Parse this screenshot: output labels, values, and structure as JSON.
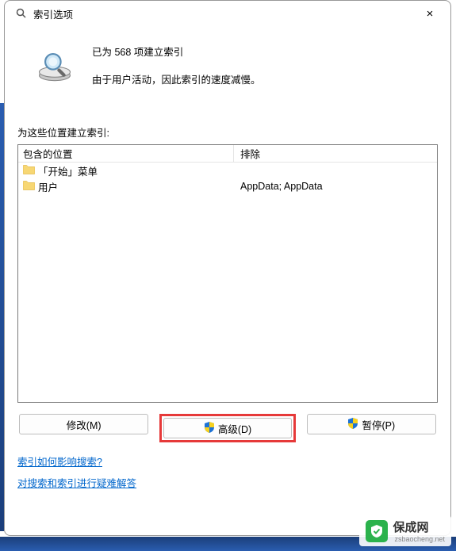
{
  "window": {
    "title": "索引选项",
    "close_label": "×"
  },
  "status": {
    "line1": "已为 568 项建立索引",
    "line2": "由于用户活动，因此索引的速度减慢。"
  },
  "locations": {
    "section_label": "为这些位置建立索引:",
    "header_included": "包含的位置",
    "header_excluded": "排除",
    "rows": [
      {
        "name": "「开始」菜单",
        "excluded": ""
      },
      {
        "name": "用户",
        "excluded": "AppData; AppData"
      }
    ]
  },
  "buttons": {
    "modify": "修改(M)",
    "advanced": "高级(D)",
    "pause": "暂停(P)"
  },
  "links": {
    "help1": "索引如何影响搜索?",
    "help2": "对搜索和索引进行疑难解答"
  },
  "watermark": {
    "text": "保成网",
    "sub": "zsbaocheng.net"
  },
  "icons": {
    "search": "search-icon",
    "close": "close-icon",
    "folder": "folder-icon",
    "shield": "shield-icon"
  }
}
